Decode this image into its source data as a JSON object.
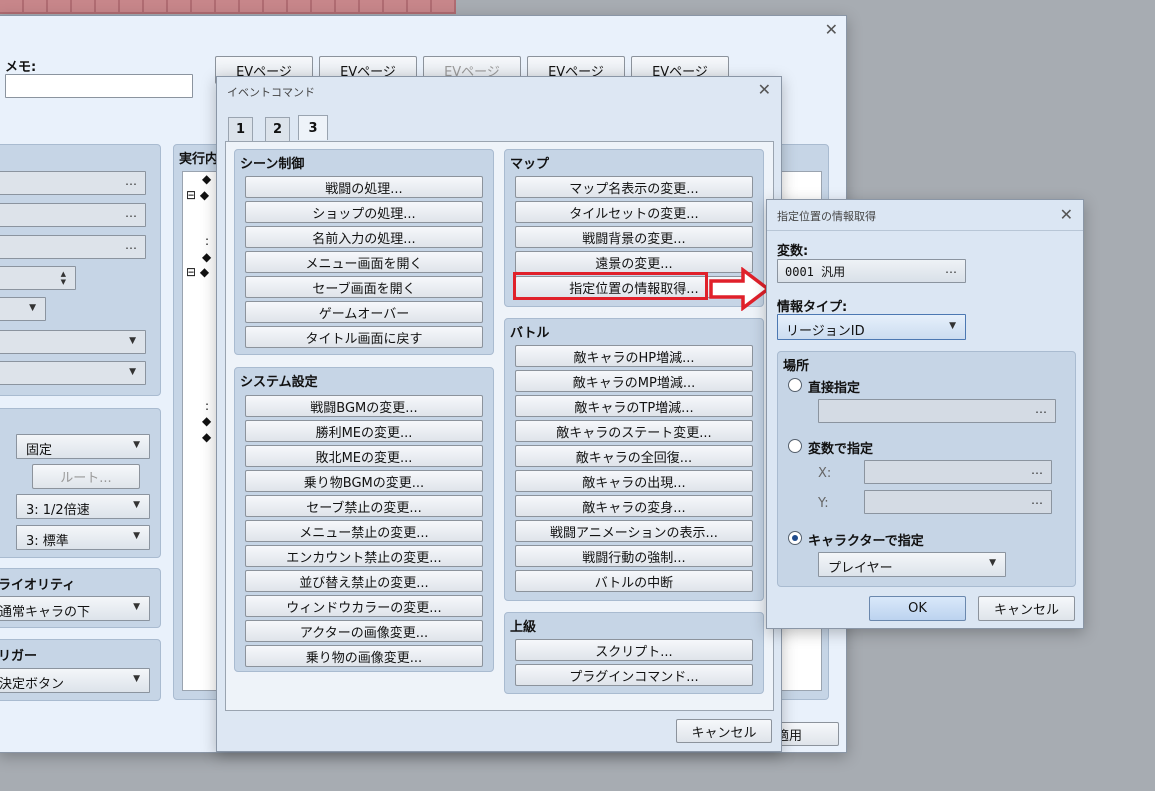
{
  "background_window": {
    "memo_label": "メモ:",
    "ev_pages": [
      "EVページ",
      "EVページ",
      "EVページ",
      "EVページ",
      "EVページ"
    ],
    "exec_label": "実行内",
    "tree_markers": [
      "◆",
      "⊟ ◆",
      ":",
      "◆",
      "⊟ ◆",
      ":",
      "◆",
      "◆"
    ],
    "fixed_value": "固定",
    "route_button": "ルート...",
    "speed_value": "3: 1/2倍速",
    "freq_value": "3: 標準",
    "priority_label": "ライオリティ",
    "priority_value": "通常キャラの下",
    "trigger_label": "リガー",
    "trigger_value": "決定ボタン",
    "apply_button": "適用"
  },
  "event_command": {
    "title": "イベントコマンド",
    "tabs": [
      "1",
      "2",
      "3"
    ],
    "scene": {
      "title": "シーン制御",
      "buttons": [
        "戦闘の処理...",
        "ショップの処理...",
        "名前入力の処理...",
        "メニュー画面を開く",
        "セーブ画面を開く",
        "ゲームオーバー",
        "タイトル画面に戻す"
      ]
    },
    "system": {
      "title": "システム設定",
      "buttons": [
        "戦闘BGMの変更...",
        "勝利MEの変更...",
        "敗北MEの変更...",
        "乗り物BGMの変更...",
        "セーブ禁止の変更...",
        "メニュー禁止の変更...",
        "エンカウント禁止の変更...",
        "並び替え禁止の変更...",
        "ウィンドウカラーの変更...",
        "アクターの画像変更...",
        "乗り物の画像変更..."
      ]
    },
    "map": {
      "title": "マップ",
      "buttons": [
        "マップ名表示の変更...",
        "タイルセットの変更...",
        "戦闘背景の変更...",
        "遠景の変更...",
        "指定位置の情報取得..."
      ]
    },
    "battle": {
      "title": "バトル",
      "buttons": [
        "敵キャラのHP増減...",
        "敵キャラのMP増減...",
        "敵キャラのTP増減...",
        "敵キャラのステート変更...",
        "敵キャラの全回復...",
        "敵キャラの出現...",
        "敵キャラの変身...",
        "戦闘アニメーションの表示...",
        "戦闘行動の強制...",
        "バトルの中断"
      ]
    },
    "advanced": {
      "title": "上級",
      "buttons": [
        "スクリプト...",
        "プラグインコマンド..."
      ]
    },
    "cancel": "キャンセル"
  },
  "location_info": {
    "title": "指定位置の情報取得",
    "variable_label": "変数:",
    "variable_value": "0001 汎用",
    "info_type_label": "情報タイプ:",
    "info_type_value": "リージョンID",
    "location_title": "場所",
    "direct_label": "直接指定",
    "by_variable_label": "変数で指定",
    "x_label": "X:",
    "y_label": "Y:",
    "by_character_label": "キャラクターで指定",
    "character_value": "プレイヤー",
    "selected_option": "キャラクターで指定",
    "ok": "OK",
    "cancel": "キャンセル"
  },
  "annotation": {
    "highlight_color": "#e0202a"
  },
  "icons": {
    "dots": "…",
    "caret": "▼",
    "close": "✕",
    "spin": "▲▼"
  }
}
